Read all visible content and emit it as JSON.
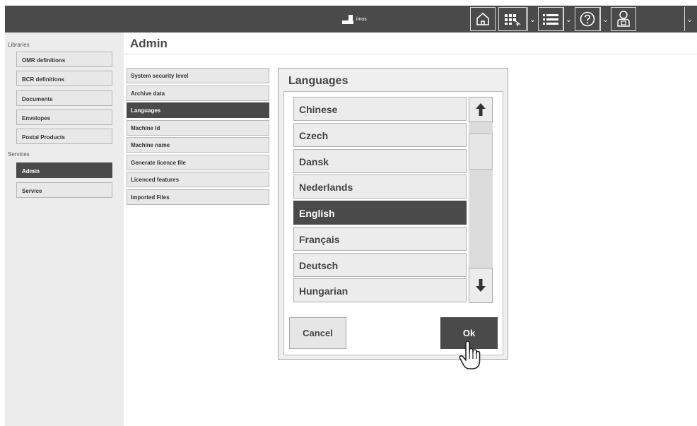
{
  "topbar": {
    "brand": "imos",
    "icons": [
      "home-icon",
      "dashboard-icon",
      "list-icon",
      "help-icon",
      "user-icon"
    ]
  },
  "sidebar": {
    "libraries_label": "Libraries",
    "libraries": [
      "OMR definitions",
      "BCR definitions",
      "Documents",
      "Envelopes",
      "Postal Products"
    ],
    "services_label": "Services",
    "services": [
      "Admin",
      "Service"
    ],
    "active": "Admin"
  },
  "main": {
    "title": "Admin",
    "admin_menu": [
      "System security level",
      "Archive data",
      "Languages",
      "Machine Id",
      "Machine name",
      "Generate licence file",
      "Licenced features",
      "Imported Files"
    ],
    "active": "Languages"
  },
  "dialog": {
    "title": "Languages",
    "languages": [
      "Chinese",
      "Czech",
      "Dansk",
      "Nederlands",
      "English",
      "Français",
      "Deutsch",
      "Hungarian"
    ],
    "selected": "English",
    "cancel_label": "Cancel",
    "ok_label": "Ok"
  },
  "colors": {
    "dark": "#4a4a4a",
    "button_bg": "#e8e8e8",
    "sidebar_bg": "#ececec",
    "border": "#b6b6b6"
  }
}
